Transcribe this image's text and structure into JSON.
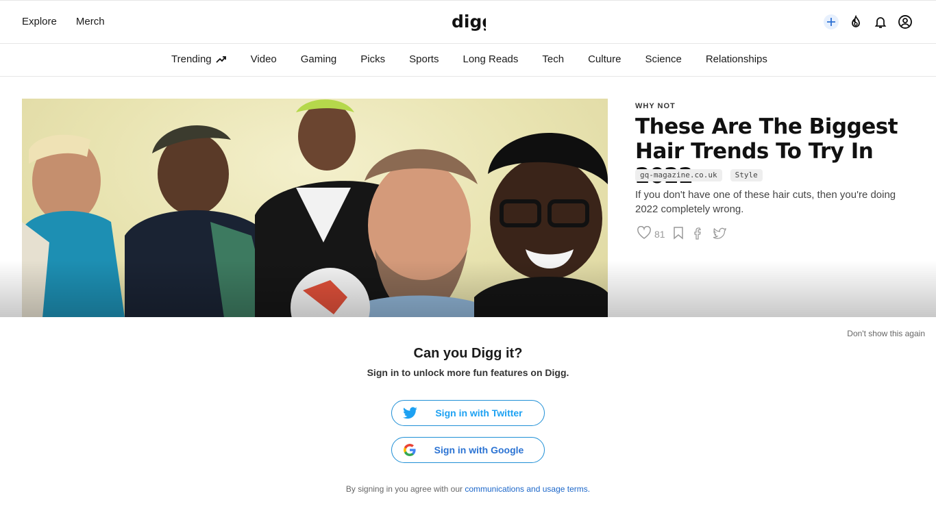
{
  "header": {
    "nav": [
      "Explore",
      "Merch"
    ],
    "logo_text": "digg",
    "icons": [
      "plus-icon",
      "digg-fire-icon",
      "bell-icon",
      "user-icon"
    ]
  },
  "categories": [
    "Trending",
    "Video",
    "Gaming",
    "Picks",
    "Sports",
    "Long Reads",
    "Tech",
    "Culture",
    "Science",
    "Relationships"
  ],
  "story": {
    "kicker": "WHY NOT",
    "headline": "These Are The Biggest Hair Trends To Try In 2022",
    "source": "gq-magazine.co.uk",
    "tag": "Style",
    "summary": "If you don't have one of these hair cuts, then you're doing 2022 completely wrong.",
    "likes": "81"
  },
  "modal": {
    "dismiss": "Don't show this again",
    "title": "Can you Digg it?",
    "subtitle": "Sign in to unlock more fun features on Digg.",
    "twitter_label": "Sign in with Twitter",
    "google_label": "Sign in with Google",
    "terms_prefix": "By signing in you agree with our ",
    "terms_link": "communications and usage terms."
  },
  "colors": {
    "twitter": "#1da1f2",
    "google_blue": "#2b73d3",
    "link": "#1b66c9"
  }
}
